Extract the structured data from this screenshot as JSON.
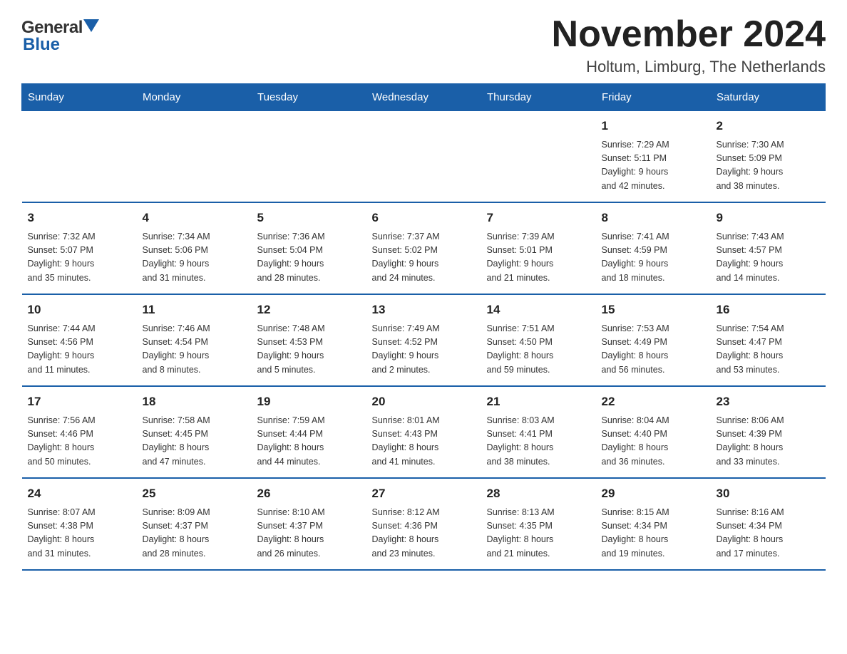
{
  "header": {
    "logo": {
      "general": "General",
      "blue": "Blue"
    },
    "month": "November 2024",
    "location": "Holtum, Limburg, The Netherlands"
  },
  "weekdays": [
    "Sunday",
    "Monday",
    "Tuesday",
    "Wednesday",
    "Thursday",
    "Friday",
    "Saturday"
  ],
  "weeks": [
    [
      {
        "day": "",
        "info": ""
      },
      {
        "day": "",
        "info": ""
      },
      {
        "day": "",
        "info": ""
      },
      {
        "day": "",
        "info": ""
      },
      {
        "day": "",
        "info": ""
      },
      {
        "day": "1",
        "info": "Sunrise: 7:29 AM\nSunset: 5:11 PM\nDaylight: 9 hours\nand 42 minutes."
      },
      {
        "day": "2",
        "info": "Sunrise: 7:30 AM\nSunset: 5:09 PM\nDaylight: 9 hours\nand 38 minutes."
      }
    ],
    [
      {
        "day": "3",
        "info": "Sunrise: 7:32 AM\nSunset: 5:07 PM\nDaylight: 9 hours\nand 35 minutes."
      },
      {
        "day": "4",
        "info": "Sunrise: 7:34 AM\nSunset: 5:06 PM\nDaylight: 9 hours\nand 31 minutes."
      },
      {
        "day": "5",
        "info": "Sunrise: 7:36 AM\nSunset: 5:04 PM\nDaylight: 9 hours\nand 28 minutes."
      },
      {
        "day": "6",
        "info": "Sunrise: 7:37 AM\nSunset: 5:02 PM\nDaylight: 9 hours\nand 24 minutes."
      },
      {
        "day": "7",
        "info": "Sunrise: 7:39 AM\nSunset: 5:01 PM\nDaylight: 9 hours\nand 21 minutes."
      },
      {
        "day": "8",
        "info": "Sunrise: 7:41 AM\nSunset: 4:59 PM\nDaylight: 9 hours\nand 18 minutes."
      },
      {
        "day": "9",
        "info": "Sunrise: 7:43 AM\nSunset: 4:57 PM\nDaylight: 9 hours\nand 14 minutes."
      }
    ],
    [
      {
        "day": "10",
        "info": "Sunrise: 7:44 AM\nSunset: 4:56 PM\nDaylight: 9 hours\nand 11 minutes."
      },
      {
        "day": "11",
        "info": "Sunrise: 7:46 AM\nSunset: 4:54 PM\nDaylight: 9 hours\nand 8 minutes."
      },
      {
        "day": "12",
        "info": "Sunrise: 7:48 AM\nSunset: 4:53 PM\nDaylight: 9 hours\nand 5 minutes."
      },
      {
        "day": "13",
        "info": "Sunrise: 7:49 AM\nSunset: 4:52 PM\nDaylight: 9 hours\nand 2 minutes."
      },
      {
        "day": "14",
        "info": "Sunrise: 7:51 AM\nSunset: 4:50 PM\nDaylight: 8 hours\nand 59 minutes."
      },
      {
        "day": "15",
        "info": "Sunrise: 7:53 AM\nSunset: 4:49 PM\nDaylight: 8 hours\nand 56 minutes."
      },
      {
        "day": "16",
        "info": "Sunrise: 7:54 AM\nSunset: 4:47 PM\nDaylight: 8 hours\nand 53 minutes."
      }
    ],
    [
      {
        "day": "17",
        "info": "Sunrise: 7:56 AM\nSunset: 4:46 PM\nDaylight: 8 hours\nand 50 minutes."
      },
      {
        "day": "18",
        "info": "Sunrise: 7:58 AM\nSunset: 4:45 PM\nDaylight: 8 hours\nand 47 minutes."
      },
      {
        "day": "19",
        "info": "Sunrise: 7:59 AM\nSunset: 4:44 PM\nDaylight: 8 hours\nand 44 minutes."
      },
      {
        "day": "20",
        "info": "Sunrise: 8:01 AM\nSunset: 4:43 PM\nDaylight: 8 hours\nand 41 minutes."
      },
      {
        "day": "21",
        "info": "Sunrise: 8:03 AM\nSunset: 4:41 PM\nDaylight: 8 hours\nand 38 minutes."
      },
      {
        "day": "22",
        "info": "Sunrise: 8:04 AM\nSunset: 4:40 PM\nDaylight: 8 hours\nand 36 minutes."
      },
      {
        "day": "23",
        "info": "Sunrise: 8:06 AM\nSunset: 4:39 PM\nDaylight: 8 hours\nand 33 minutes."
      }
    ],
    [
      {
        "day": "24",
        "info": "Sunrise: 8:07 AM\nSunset: 4:38 PM\nDaylight: 8 hours\nand 31 minutes."
      },
      {
        "day": "25",
        "info": "Sunrise: 8:09 AM\nSunset: 4:37 PM\nDaylight: 8 hours\nand 28 minutes."
      },
      {
        "day": "26",
        "info": "Sunrise: 8:10 AM\nSunset: 4:37 PM\nDaylight: 8 hours\nand 26 minutes."
      },
      {
        "day": "27",
        "info": "Sunrise: 8:12 AM\nSunset: 4:36 PM\nDaylight: 8 hours\nand 23 minutes."
      },
      {
        "day": "28",
        "info": "Sunrise: 8:13 AM\nSunset: 4:35 PM\nDaylight: 8 hours\nand 21 minutes."
      },
      {
        "day": "29",
        "info": "Sunrise: 8:15 AM\nSunset: 4:34 PM\nDaylight: 8 hours\nand 19 minutes."
      },
      {
        "day": "30",
        "info": "Sunrise: 8:16 AM\nSunset: 4:34 PM\nDaylight: 8 hours\nand 17 minutes."
      }
    ]
  ]
}
